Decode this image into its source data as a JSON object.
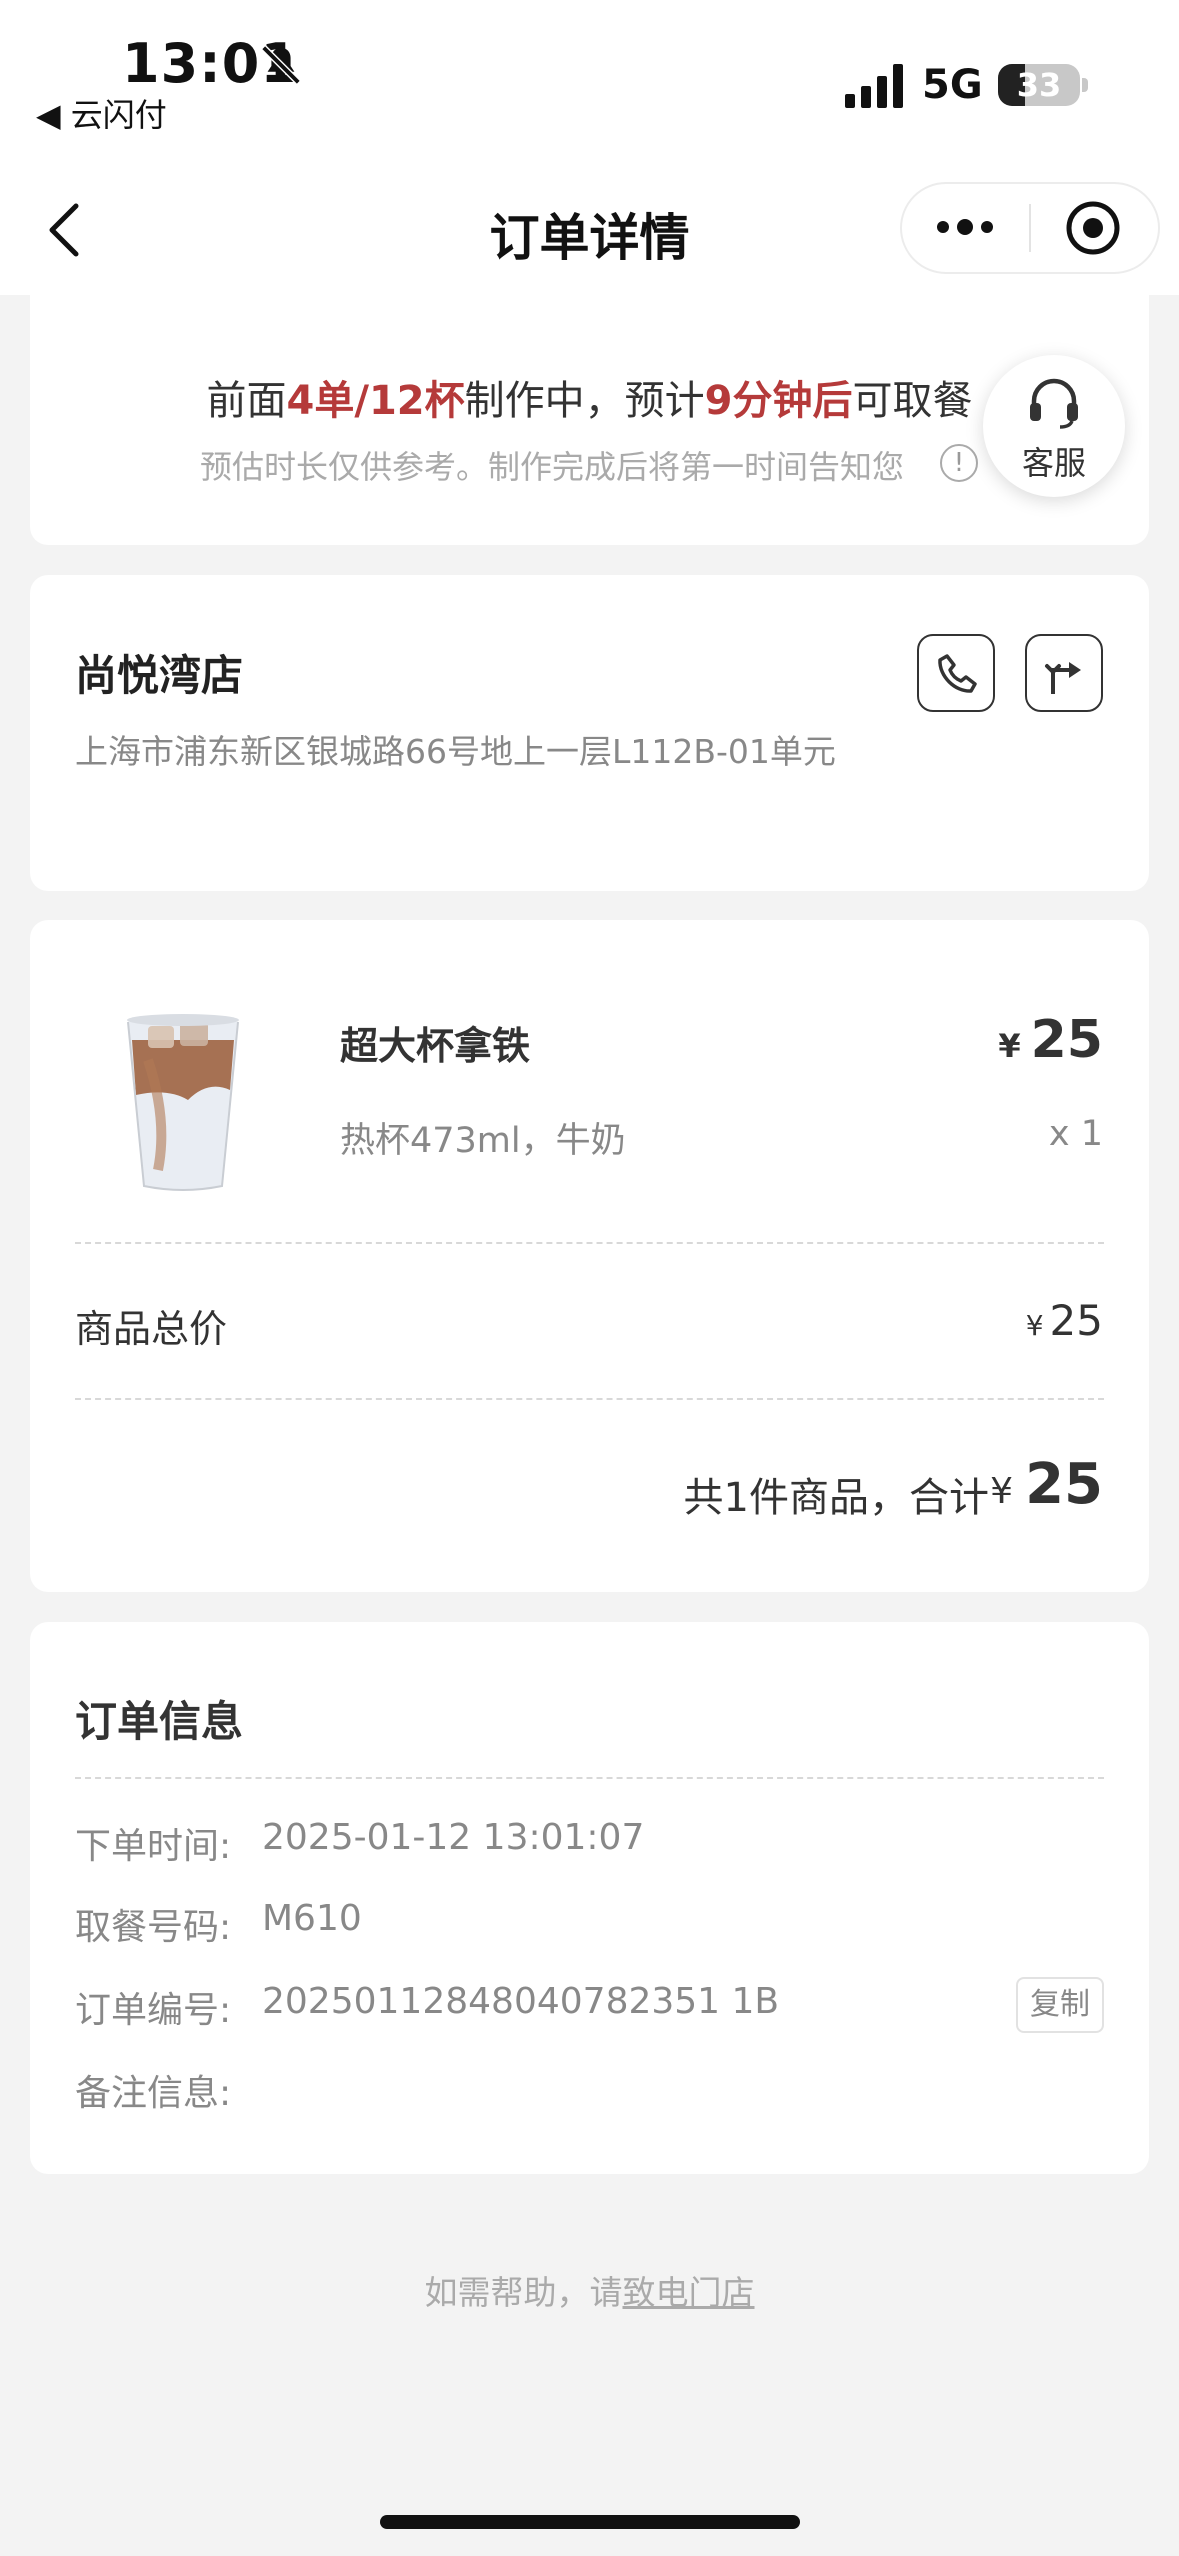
{
  "status_bar": {
    "time": "13:01",
    "back_app": "◀ 云闪付",
    "network": "5G",
    "battery": "33",
    "battery_level": 0.33
  },
  "nav": {
    "title": "订单详情"
  },
  "queue": {
    "prefix": "前面",
    "orders_cups": "4单/12杯",
    "middle": "制作中，预计",
    "wait_time": "9分钟后",
    "suffix": "可取餐",
    "hint": "预估时长仅供参考。制作完成后将第一时间告知您",
    "info_glyph": "!"
  },
  "customer_service": {
    "label": "客服"
  },
  "store": {
    "name": "尚悦湾店",
    "address": "上海市浦东新区银城路66号地上一层L112B-01单元"
  },
  "product": {
    "name": "超大杯拿铁",
    "spec": "热杯473ml，牛奶",
    "currency": "¥",
    "price": "25",
    "qty": "x 1"
  },
  "summary": {
    "subtotal_label": "商品总价",
    "subtotal_currency": "¥",
    "subtotal_value": "25",
    "total_label": "共1件商品，合计",
    "total_currency": "¥",
    "total_value": "25"
  },
  "order_info": {
    "title": "订单信息",
    "rows": [
      {
        "label": "下单时间:",
        "value": "2025-01-12 13:01:07"
      },
      {
        "label": "取餐号码:",
        "value": "M610"
      },
      {
        "label": "订单编号:",
        "value": "20250112848040782351 1B"
      },
      {
        "label": "备注信息:",
        "value": ""
      }
    ],
    "copy_label": "复制"
  },
  "footer": {
    "help_prefix": "如需帮助，请",
    "help_link": "致电门店"
  },
  "icons": {
    "nav_back": "chevron-left-icon",
    "more": "more-dots-icon",
    "close_miniapp": "target-icon",
    "customer_service": "headset-icon",
    "phone": "phone-icon",
    "route": "route-icon",
    "mute": "bell-slash-icon",
    "signal": "signal-bars-icon"
  },
  "colors": {
    "accent_red": "#b53a3a",
    "background": "#f3f3f3"
  }
}
